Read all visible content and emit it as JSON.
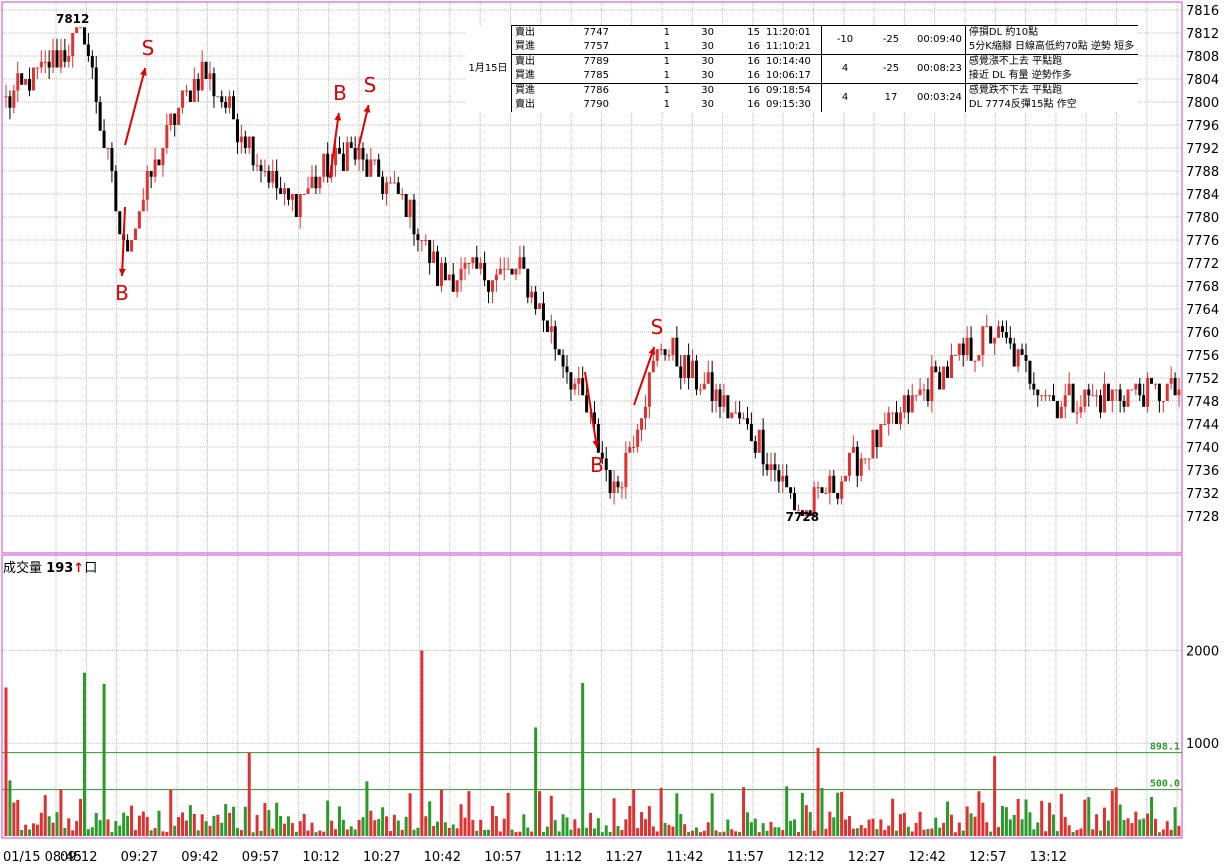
{
  "colors": {
    "up": "#e03030",
    "down": "#000000",
    "vol_up": "#e03030",
    "vol_down": "#2a9a2a",
    "grid": "#bbbbbb",
    "frame": "#d040d0",
    "ref_line": "#2a9a2a",
    "annotation": "#e00000"
  },
  "price_axis": {
    "min": 7726,
    "max": 7816,
    "ticks": [
      "7816",
      "7812",
      "7808",
      "7804",
      "7800",
      "7796",
      "7792",
      "7788",
      "7784",
      "7780",
      "7776",
      "7772",
      "7768",
      "7764",
      "7760",
      "7756",
      "7752",
      "7748",
      "7744",
      "7740",
      "7736",
      "7732",
      "7728"
    ]
  },
  "volume_axis": {
    "min": 0,
    "max": 2500,
    "ticks": [
      "2000",
      "1000"
    ]
  },
  "x_axis": {
    "labels": [
      "01/15 08:45",
      "09:12",
      "09:27",
      "09:42",
      "09:57",
      "10:12",
      "10:27",
      "10:42",
      "10:57",
      "11:12",
      "11:27",
      "11:42",
      "11:57",
      "12:12",
      "12:27",
      "12:42",
      "12:57",
      "13:12"
    ]
  },
  "extremes": {
    "high_label": "7812",
    "low_label": "7728"
  },
  "volume_panel": {
    "title": "成交量",
    "current_value": "193",
    "arrow": "↑",
    "box": "口"
  },
  "volume_refs": [
    {
      "value": 898.1,
      "label": "898.1"
    },
    {
      "value": 500,
      "label": "500.0"
    }
  ],
  "annotations": [
    {
      "label": "S",
      "arrow": "up",
      "index": 20
    },
    {
      "label": "B",
      "arrow": "down",
      "index": 21
    },
    {
      "label": "B",
      "arrow": "up",
      "index": 54
    },
    {
      "label": "S",
      "arrow": "up",
      "index": 59
    },
    {
      "label": "B",
      "arrow": "down",
      "index": 97
    },
    {
      "label": "S",
      "arrow": "up",
      "index": 105
    }
  ],
  "trades": {
    "date": "1月15日",
    "groups": [
      {
        "rows": [
          {
            "side": "賣出",
            "price": "7747",
            "qty": "1",
            "pv": "30",
            "fee": "15",
            "time": "11:20:01"
          },
          {
            "side": "買進",
            "price": "7757",
            "qty": "1",
            "pv": "30",
            "fee": "16",
            "time": "11:10:21"
          }
        ],
        "pts": "-10",
        "pl": "-25",
        "dur": "00:09:40",
        "notes": [
          "停損DL 約10點",
          "5分K縮腳 日線高低約70點 逆勢 短多"
        ]
      },
      {
        "rows": [
          {
            "side": "賣出",
            "price": "7789",
            "qty": "1",
            "pv": "30",
            "fee": "16",
            "time": "10:14:40"
          },
          {
            "side": "買進",
            "price": "7785",
            "qty": "1",
            "pv": "30",
            "fee": "16",
            "time": "10:06:17"
          }
        ],
        "pts": "4",
        "pl": "-25",
        "dur": "00:08:23",
        "notes": [
          "感覺漲不上去 平點跑",
          "接近 DL 有量 逆勢作多"
        ]
      },
      {
        "rows": [
          {
            "side": "買進",
            "price": "7786",
            "qty": "1",
            "pv": "30",
            "fee": "16",
            "time": "09:18:54"
          },
          {
            "side": "賣出",
            "price": "7790",
            "qty": "1",
            "pv": "30",
            "fee": "16",
            "time": "09:15:30"
          }
        ],
        "pts": "4",
        "pl": "17",
        "dur": "00:03:24",
        "notes": [
          "感覺跌不下去 平點跑",
          "DL 7774反彈15點 作空"
        ]
      }
    ]
  },
  "chart_data": {
    "type": "candlestick",
    "interval": "1 minute",
    "x_range": [
      "08:45",
      "13:45"
    ],
    "y_range": [
      7726,
      7816
    ],
    "key_prices": [
      {
        "time": "08:45",
        "price": 7800
      },
      {
        "time": "09:05",
        "price": 7812
      },
      {
        "time": "09:15",
        "price": 7774
      },
      {
        "time": "09:27",
        "price": 7796
      },
      {
        "time": "09:35",
        "price": 7806
      },
      {
        "time": "09:57",
        "price": 7782
      },
      {
        "time": "10:12",
        "price": 7792
      },
      {
        "time": "10:27",
        "price": 7782
      },
      {
        "time": "10:35",
        "price": 7770
      },
      {
        "time": "10:57",
        "price": 7770
      },
      {
        "time": "11:12",
        "price": 7748
      },
      {
        "time": "11:20",
        "price": 7732
      },
      {
        "time": "11:32",
        "price": 7758
      },
      {
        "time": "11:57",
        "price": 7741
      },
      {
        "time": "12:08",
        "price": 7728
      },
      {
        "time": "12:27",
        "price": 7741
      },
      {
        "time": "12:42",
        "price": 7752
      },
      {
        "time": "12:57",
        "price": 7760
      },
      {
        "time": "13:12",
        "price": 7748
      },
      {
        "time": "13:45",
        "price": 7750
      }
    ],
    "volume_events": [
      {
        "time": "08:45",
        "volume": 1600
      },
      {
        "time": "09:05",
        "volume": 1760
      },
      {
        "time": "09:10",
        "volume": 1640
      },
      {
        "time": "09:47",
        "volume": 900
      },
      {
        "time": "10:31",
        "volume": 2000
      },
      {
        "time": "11:00",
        "volume": 1170
      },
      {
        "time": "11:12",
        "volume": 1650
      },
      {
        "time": "12:12",
        "volume": 950
      },
      {
        "time": "12:57",
        "volume": 860
      }
    ]
  }
}
